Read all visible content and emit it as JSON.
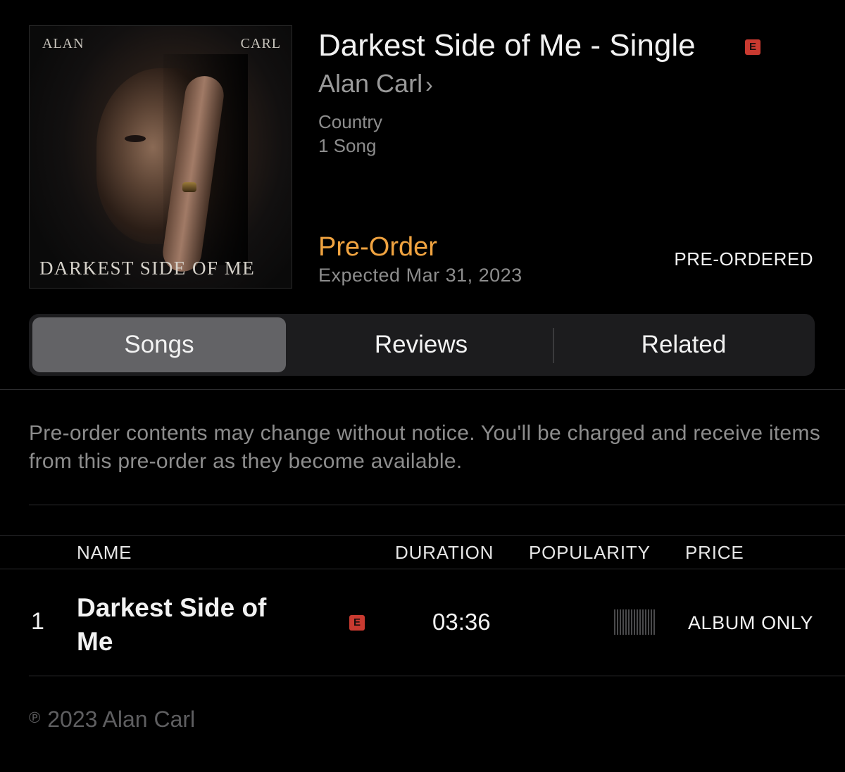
{
  "album": {
    "art": {
      "first_name": "ALAN",
      "last_name": "CARL",
      "title": "DARKEST SIDE OF ME"
    },
    "title": "Darkest Side of Me - Single",
    "explicit_badge": "E",
    "artist": "Alan Carl",
    "artist_chevron": "›",
    "genre": "Country",
    "song_count": "1 Song",
    "preorder_label": "Pre-Order",
    "expected": "Expected Mar 31, 2023",
    "preordered_status": "PRE-ORDERED"
  },
  "tabs": [
    {
      "label": "Songs",
      "active": true
    },
    {
      "label": "Reviews",
      "active": false
    },
    {
      "label": "Related",
      "active": false
    }
  ],
  "notice": "Pre-order contents may change without notice. You'll be charged and receive items from this pre-order as they become available.",
  "table": {
    "headers": {
      "name": "NAME",
      "duration": "DURATION",
      "popularity": "POPULARITY",
      "price": "PRICE"
    },
    "rows": [
      {
        "number": "1",
        "title": "Darkest Side of Me",
        "explicit": "E",
        "duration": "03:36",
        "price": "ALBUM ONLY"
      }
    ]
  },
  "copyright": {
    "symbol": "℗",
    "text": "2023 Alan Carl"
  },
  "colors": {
    "background": "#000000",
    "accent": "#f0a340",
    "explicit": "#c93a30",
    "secondary_text": "#8d8d8d",
    "segment_active": "#636366"
  }
}
